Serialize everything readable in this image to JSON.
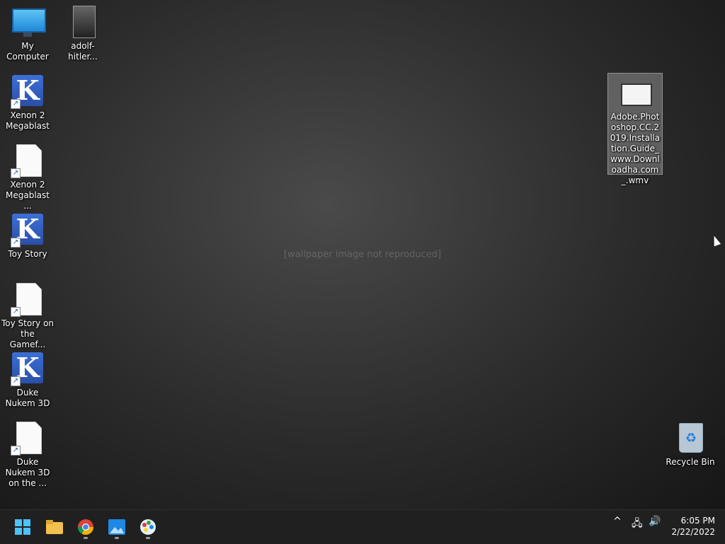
{
  "desktop": {
    "wallpaper_note": "[wallpaper image not reproduced]",
    "icons": [
      {
        "label": "My Computer",
        "icon": "computer-icon"
      },
      {
        "label": "adolf-hitler...",
        "icon": "image-file-icon"
      },
      {
        "label": "Xenon 2 Megablast",
        "icon": "app-shortcut-icon"
      },
      {
        "label": "Xenon 2 Megablast ...",
        "icon": "document-shortcut-icon"
      },
      {
        "label": "Toy Story",
        "icon": "app-shortcut-icon"
      },
      {
        "label": "Toy Story on the Gamef...",
        "icon": "document-shortcut-icon"
      },
      {
        "label": "Duke Nukem 3D",
        "icon": "app-shortcut-icon"
      },
      {
        "label": "Duke Nukem 3D on the ...",
        "icon": "document-shortcut-icon"
      },
      {
        "label": "Adobe.Photoshop.CC.2019.Installation.Guide_www.Downloadha.com_.wmv",
        "icon": "video-file-icon"
      },
      {
        "label": "Recycle Bin",
        "icon": "recycle-bin-icon"
      }
    ]
  },
  "taskbar": {
    "apps": [
      "start-icon",
      "file-explorer-icon",
      "chrome-icon",
      "photos-icon",
      "paint-icon"
    ],
    "tray": {
      "chevron": "^",
      "network": "network-icon",
      "volume": "volume-icon"
    },
    "clock": {
      "time": "6:05 PM",
      "date": "2/22/2022"
    }
  },
  "colors": {
    "taskbar": "#202020",
    "accent": "#0078d4"
  }
}
